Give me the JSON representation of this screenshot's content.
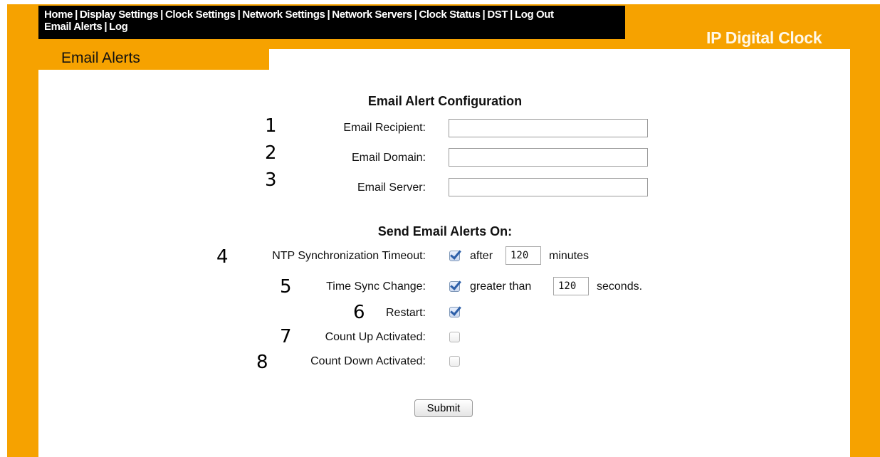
{
  "nav": {
    "items": [
      "Home",
      "Display Settings",
      "Clock Settings",
      "Network Settings",
      "Network Servers",
      "Clock Status",
      "DST",
      "Log Out",
      "Email Alerts",
      "Log"
    ]
  },
  "brand": "IP Digital Clock",
  "section": {
    "title": "Email Alerts"
  },
  "config": {
    "heading": "Email Alert Configuration",
    "fields": [
      {
        "num": "1",
        "label": "Email Recipient:",
        "value": ""
      },
      {
        "num": "2",
        "label": "Email Domain:",
        "value": ""
      },
      {
        "num": "3",
        "label": "Email Server:",
        "value": ""
      }
    ]
  },
  "alerts": {
    "heading": "Send Email Alerts On:",
    "ntp": {
      "num": "4",
      "label": "NTP Synchronization Timeout:",
      "checked": true,
      "prefix": "after",
      "value": "120",
      "suffix": "minutes"
    },
    "sync": {
      "num": "5",
      "label": "Time Sync Change:",
      "checked": true,
      "prefix": "greater than",
      "value": "120",
      "suffix": "seconds."
    },
    "restart": {
      "num": "6",
      "label": "Restart:",
      "checked": true
    },
    "countup": {
      "num": "7",
      "label": "Count Up Activated:",
      "checked": false
    },
    "countdown": {
      "num": "8",
      "label": "Count Down Activated:",
      "checked": false
    }
  },
  "submit_label": "Submit",
  "colors": {
    "frame": "#f6a200",
    "nav_bg": "#000000",
    "panel": "#ffffff"
  }
}
